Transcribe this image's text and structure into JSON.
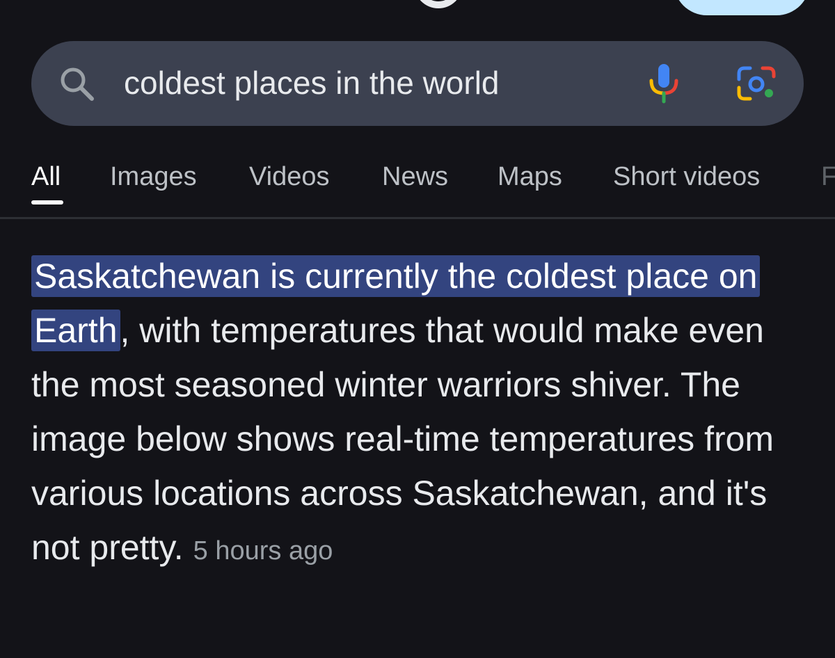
{
  "search": {
    "query": "coldest places in the world"
  },
  "tabs": [
    {
      "label": "All",
      "active": true
    },
    {
      "label": "Images"
    },
    {
      "label": "Videos"
    },
    {
      "label": "News"
    },
    {
      "label": "Maps"
    },
    {
      "label": "Short videos"
    },
    {
      "label": "F"
    }
  ],
  "snippet": {
    "highlight": "Saskatchewan is currently the coldest place on Earth",
    "body": ", with temperatures that would make even the most seasoned winter warriors shiver. The image below shows real-time temperatures from various locations across Saskatchewan, and it's not pretty.",
    "time": "5 hours ago"
  },
  "icons": {
    "search": "search-icon",
    "mic": "mic-icon",
    "lens": "lens-icon"
  },
  "colors": {
    "background": "#131318",
    "search_bar": "#3c4150",
    "highlight": "#33447f",
    "text": "#e8eaed",
    "muted": "#9aa0a6"
  }
}
